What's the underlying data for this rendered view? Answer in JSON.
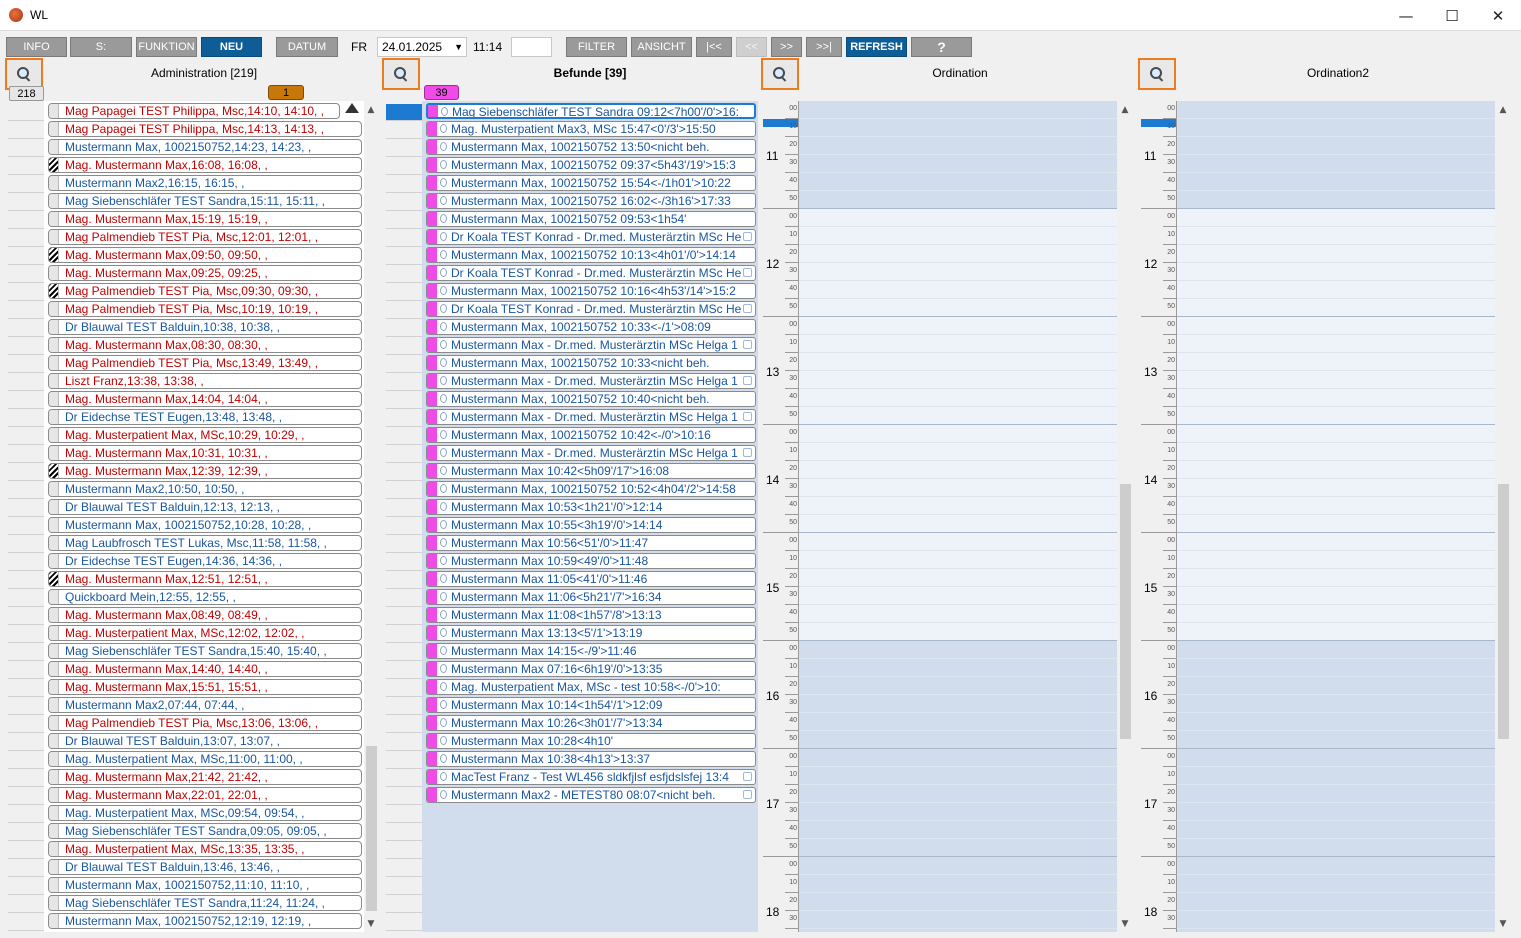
{
  "window": {
    "title": "WL",
    "minimize": "—",
    "maximize": "☐",
    "close": "✕"
  },
  "toolbar": {
    "info": "INFO",
    "s": "S:",
    "funktion": "FUNKTION",
    "neu": "NEU",
    "datum": "DATUM",
    "day": "FR",
    "date": "24.01.2025",
    "time": "11:14",
    "filter": "FILTER",
    "ansicht": "ANSICHT",
    "first": "|<<",
    "prev": "<<",
    "next": ">>",
    "last": ">>|",
    "refresh": "REFRESH",
    "help": "?"
  },
  "admin": {
    "title": "Administration [219]",
    "badge": "1",
    "counter": "218",
    "rows": [
      {
        "text": "Mag Papagei TEST Philippa, Msc,14:10, 14:10, ,",
        "color": "red",
        "hatch": false
      },
      {
        "text": "Mag Papagei TEST Philippa, Msc,14:13, 14:13, ,",
        "color": "red",
        "hatch": false
      },
      {
        "text": "Mustermann Max, 1002150752,14:23, 14:23, ,",
        "color": "blue",
        "hatch": false
      },
      {
        "text": "Mag. Mustermann Max,16:08, 16:08, ,",
        "color": "red",
        "hatch": true
      },
      {
        "text": "Mustermann Max2,16:15, 16:15, ,",
        "color": "blue",
        "hatch": false
      },
      {
        "text": "Mag Siebenschläfer TEST Sandra,15:11, 15:11, ,",
        "color": "blue",
        "hatch": false
      },
      {
        "text": "Mag. Mustermann Max,15:19, 15:19, ,",
        "color": "red",
        "hatch": false
      },
      {
        "text": "Mag Palmendieb TEST Pia, Msc,12:01, 12:01, ,",
        "color": "red",
        "hatch": false
      },
      {
        "text": "Mag. Mustermann Max,09:50, 09:50, ,",
        "color": "red",
        "hatch": true
      },
      {
        "text": "Mag. Mustermann Max,09:25, 09:25, ,",
        "color": "red",
        "hatch": false
      },
      {
        "text": "Mag Palmendieb TEST Pia, Msc,09:30, 09:30, ,",
        "color": "red",
        "hatch": true
      },
      {
        "text": "Mag Palmendieb TEST Pia, Msc,10:19, 10:19, ,",
        "color": "red",
        "hatch": false
      },
      {
        "text": "Dr Blauwal TEST Balduin,10:38, 10:38, ,",
        "color": "blue",
        "hatch": false
      },
      {
        "text": "Mag. Mustermann Max,08:30, 08:30, ,",
        "color": "red",
        "hatch": false
      },
      {
        "text": "Mag Palmendieb TEST Pia, Msc,13:49, 13:49, ,",
        "color": "red",
        "hatch": false
      },
      {
        "text": "Liszt Franz,13:38, 13:38, ,",
        "color": "red",
        "hatch": false
      },
      {
        "text": "Mag. Mustermann Max,14:04, 14:04, ,",
        "color": "red",
        "hatch": false
      },
      {
        "text": "Dr Eidechse TEST Eugen,13:48, 13:48, ,",
        "color": "blue",
        "hatch": false
      },
      {
        "text": "Mag. Musterpatient Max, MSc,10:29, 10:29, ,",
        "color": "red",
        "hatch": false
      },
      {
        "text": "Mag. Mustermann Max,10:31, 10:31, ,",
        "color": "red",
        "hatch": false
      },
      {
        "text": "Mag. Mustermann Max,12:39, 12:39, ,",
        "color": "red",
        "hatch": true
      },
      {
        "text": "Mustermann Max2,10:50, 10:50, ,",
        "color": "blue",
        "hatch": false
      },
      {
        "text": "Dr Blauwal TEST Balduin,12:13, 12:13, ,",
        "color": "blue",
        "hatch": false
      },
      {
        "text": "Mustermann Max, 1002150752,10:28, 10:28, ,",
        "color": "blue",
        "hatch": false
      },
      {
        "text": "Mag Laubfrosch TEST Lukas, Msc,11:58, 11:58, ,",
        "color": "blue",
        "hatch": false
      },
      {
        "text": "Dr Eidechse TEST Eugen,14:36, 14:36, ,",
        "color": "blue",
        "hatch": false
      },
      {
        "text": "Mag. Mustermann Max,12:51, 12:51, ,",
        "color": "red",
        "hatch": true
      },
      {
        "text": "Quickboard Mein,12:55, 12:55, ,",
        "color": "blue",
        "hatch": false
      },
      {
        "text": "Mag. Mustermann Max,08:49, 08:49, ,",
        "color": "red",
        "hatch": false
      },
      {
        "text": "Mag. Musterpatient Max, MSc,12:02, 12:02, ,",
        "color": "red",
        "hatch": false
      },
      {
        "text": "Mag Siebenschläfer TEST Sandra,15:40, 15:40, ,",
        "color": "blue",
        "hatch": false
      },
      {
        "text": "Mag. Mustermann Max,14:40, 14:40, ,",
        "color": "red",
        "hatch": false
      },
      {
        "text": "Mag. Mustermann Max,15:51, 15:51, ,",
        "color": "red",
        "hatch": false
      },
      {
        "text": "Mustermann Max2,07:44, 07:44, ,",
        "color": "blue",
        "hatch": false
      },
      {
        "text": "Mag Palmendieb TEST Pia, Msc,13:06, 13:06, ,",
        "color": "red",
        "hatch": false
      },
      {
        "text": "Dr Blauwal TEST Balduin,13:07, 13:07, ,",
        "color": "blue",
        "hatch": false
      },
      {
        "text": "Mag. Musterpatient Max, MSc,11:00, 11:00, ,",
        "color": "blue",
        "hatch": false
      },
      {
        "text": "Mag. Mustermann Max,21:42, 21:42, ,",
        "color": "red",
        "hatch": false
      },
      {
        "text": "Mag. Mustermann Max,22:01, 22:01, ,",
        "color": "red",
        "hatch": false
      },
      {
        "text": "Mag. Musterpatient Max, MSc,09:54, 09:54, ,",
        "color": "blue",
        "hatch": false
      },
      {
        "text": "Mag Siebenschläfer TEST Sandra,09:05, 09:05, ,",
        "color": "blue",
        "hatch": false
      },
      {
        "text": "Mag. Musterpatient Max, MSc,13:35, 13:35, ,",
        "color": "red",
        "hatch": false
      },
      {
        "text": "Dr Blauwal TEST Balduin,13:46, 13:46, ,",
        "color": "blue",
        "hatch": false
      },
      {
        "text": "Mustermann Max, 1002150752,11:10, 11:10, ,",
        "color": "blue",
        "hatch": false
      },
      {
        "text": "Mag Siebenschläfer TEST Sandra,11:24, 11:24, ,",
        "color": "blue",
        "hatch": false
      },
      {
        "text": "Mustermann Max, 1002150752,12:19, 12:19, ,",
        "color": "blue",
        "hatch": false
      }
    ]
  },
  "befunde": {
    "title": "Befunde [39]",
    "badge": "39",
    "rows": [
      {
        "text": "Mag Siebenschläfer TEST Sandra 09:12<7h00'/0'>16:",
        "att": false
      },
      {
        "text": "Mag. Musterpatient Max3, MSc 15:47<0'/3'>15:50",
        "att": false
      },
      {
        "text": "Mustermann Max, 1002150752 13:50<nicht beh.",
        "att": false
      },
      {
        "text": "Mustermann Max, 1002150752 09:37<5h43'/19'>15:3",
        "att": false
      },
      {
        "text": "Mustermann Max, 1002150752 15:54<-/1h01'>10:22",
        "att": false
      },
      {
        "text": "Mustermann Max, 1002150752 16:02<-/3h16'>17:33",
        "att": false
      },
      {
        "text": "Mustermann Max, 1002150752 09:53<1h54'",
        "att": false
      },
      {
        "text": "Dr Koala TEST Konrad - Dr.med. Musterärztin MSc He",
        "att": true
      },
      {
        "text": "Mustermann Max, 1002150752 10:13<4h01'/0'>14:14",
        "att": false
      },
      {
        "text": "Dr Koala TEST Konrad - Dr.med. Musterärztin MSc He",
        "att": true
      },
      {
        "text": "Mustermann Max, 1002150752 10:16<4h53'/14'>15:2",
        "att": false
      },
      {
        "text": "Dr Koala TEST Konrad - Dr.med. Musterärztin MSc He",
        "att": true
      },
      {
        "text": "Mustermann Max, 1002150752 10:33<-/1'>08:09",
        "att": false
      },
      {
        "text": "Mustermann Max - Dr.med. Musterärztin MSc Helga 1",
        "att": true
      },
      {
        "text": "Mustermann Max, 1002150752 10:33<nicht beh.",
        "att": false
      },
      {
        "text": "Mustermann Max - Dr.med. Musterärztin MSc Helga 1",
        "att": true
      },
      {
        "text": "Mustermann Max, 1002150752 10:40<nicht beh.",
        "att": false
      },
      {
        "text": "Mustermann Max - Dr.med. Musterärztin MSc Helga 1",
        "att": true
      },
      {
        "text": "Mustermann Max, 1002150752 10:42<-/0'>10:16",
        "att": false
      },
      {
        "text": "Mustermann Max - Dr.med. Musterärztin MSc Helga 1",
        "att": true
      },
      {
        "text": "Mustermann Max 10:42<5h09'/17'>16:08",
        "att": false
      },
      {
        "text": "Mustermann Max, 1002150752 10:52<4h04'/2'>14:58",
        "att": false
      },
      {
        "text": "Mustermann Max 10:53<1h21'/0'>12:14",
        "att": false
      },
      {
        "text": "Mustermann Max 10:55<3h19'/0'>14:14",
        "att": false
      },
      {
        "text": "Mustermann Max 10:56<51'/0'>11:47",
        "att": false
      },
      {
        "text": "Mustermann Max 10:59<49'/0'>11:48",
        "att": false
      },
      {
        "text": "Mustermann Max 11:05<41'/0'>11:46",
        "att": false
      },
      {
        "text": "Mustermann Max 11:06<5h21'/7'>16:34",
        "att": false
      },
      {
        "text": "Mustermann Max 11:08<1h57'/8'>13:13",
        "att": false
      },
      {
        "text": "Mustermann Max 13:13<5'/1'>13:19",
        "att": false
      },
      {
        "text": "Mustermann Max 14:15<-/9'>11:46",
        "att": false
      },
      {
        "text": "Mustermann Max 07:16<6h19'/0'>13:35",
        "att": false
      },
      {
        "text": "Mag. Musterpatient Max, MSc - test 10:58<-/0'>10:",
        "att": false
      },
      {
        "text": "Mustermann Max 10:14<1h54'/1'>12:09",
        "att": false
      },
      {
        "text": "Mustermann Max 10:26<3h01'/7'>13:34",
        "att": false
      },
      {
        "text": "Mustermann Max 10:28<4h10'",
        "att": false
      },
      {
        "text": "Mustermann Max 10:38<4h13'>13:37",
        "att": false
      },
      {
        "text": "MacTest Franz - Test WL456 sldkfjlsf esfjdslsfej 13:4",
        "att": true
      },
      {
        "text": "Mustermann Max2 - METEST80 08:07<nicht beh.",
        "att": true
      }
    ]
  },
  "ordination": {
    "title": "Ordination",
    "hours": [
      "11",
      "12",
      "13",
      "14",
      "15",
      "16",
      "17",
      "18"
    ],
    "minutes": [
      "00",
      "10",
      "20",
      "30",
      "40",
      "50"
    ]
  },
  "ordination2": {
    "title": "Ordination2"
  },
  "colors": {
    "accent": "#0f5d96",
    "search_border": "#ec7d1c",
    "pink": "#f04ae8",
    "badge_brown": "#c8780a",
    "red_text": "#c00000",
    "blue_text": "#1a56a0",
    "cal_blue": "#d1dcec",
    "cal_light": "#eef3fa"
  }
}
